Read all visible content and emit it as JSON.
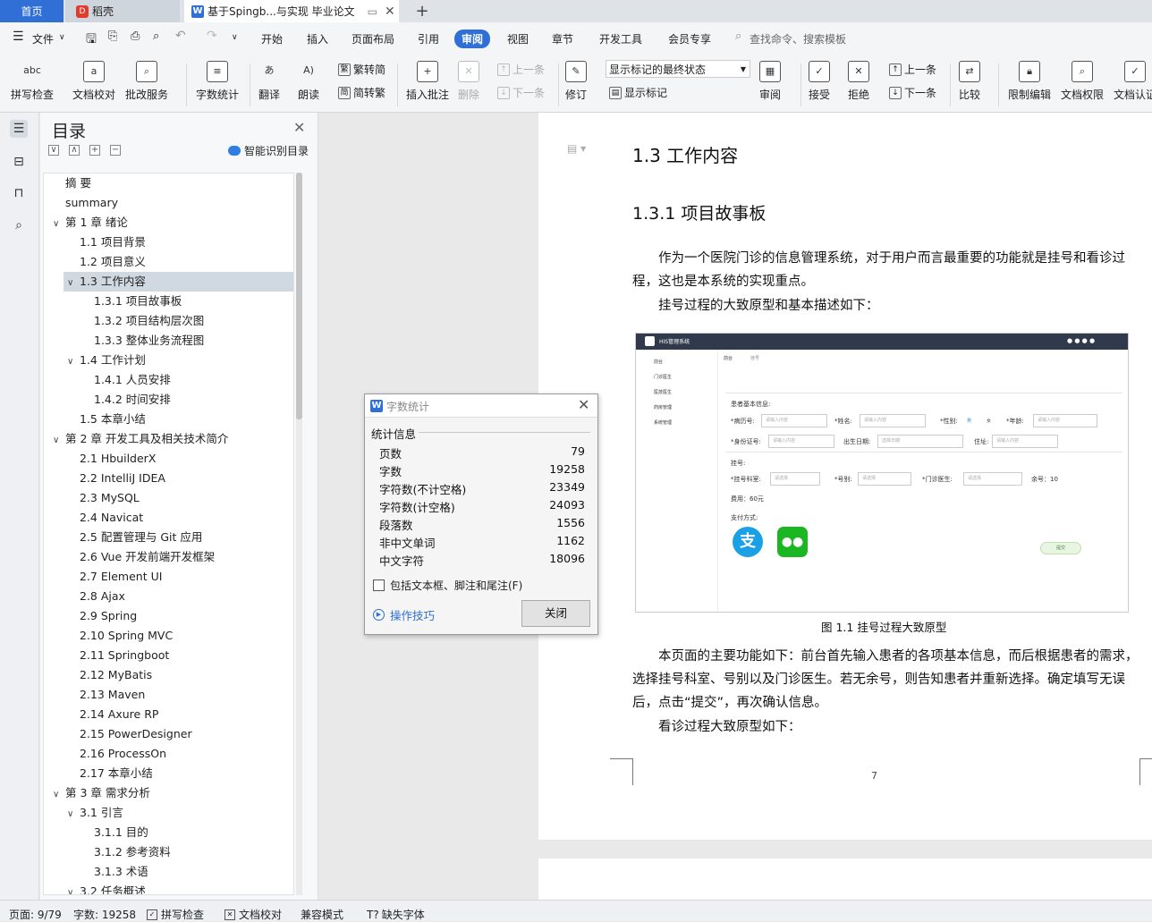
{
  "tabs": {
    "home": "首页",
    "daoke": "稻壳",
    "doc": "基于Spingb...与实现 毕业论文",
    "new_tab": "+"
  },
  "menubar": {
    "file": "文件",
    "items": [
      "开始",
      "插入",
      "页面布局",
      "引用",
      "审阅",
      "视图",
      "章节",
      "开发工具",
      "会员专享"
    ],
    "active": "审阅",
    "search_placeholder": "查找命令、搜索模板"
  },
  "ribbon": {
    "spell_check": "拼写检查",
    "doc_proof": "文档校对",
    "correction": "批改服务",
    "word_count": "字数统计",
    "translate": "翻译",
    "read_aloud": "朗读",
    "to_simplified": "繁转简",
    "to_traditional": "简转繁",
    "insert_comment": "插入批注",
    "delete": "删除",
    "prev": "上一条",
    "next": "下一条",
    "revise": "修订",
    "markup_state": "显示标记的最终状态",
    "show_markup": "显示标记",
    "review": "审阅",
    "accept": "接受",
    "reject": "拒绝",
    "prev2": "上一条",
    "next2": "下一条",
    "compare": "比较",
    "restrict_edit": "限制编辑",
    "doc_rights": "文档权限",
    "doc_cert": "文档认证"
  },
  "toc": {
    "title": "目录",
    "smart": "智能识别目录",
    "items": [
      {
        "text": "摘  要",
        "level": 0,
        "chev": ""
      },
      {
        "text": "summary",
        "level": 0,
        "chev": ""
      },
      {
        "text": "第 1 章   绪论",
        "level": 0,
        "chev": "∨"
      },
      {
        "text": "1.1  项目背景",
        "level": 1,
        "chev": ""
      },
      {
        "text": "1.2  项目意义",
        "level": 1,
        "chev": ""
      },
      {
        "text": "1.3  工作内容",
        "level": 1,
        "chev": "∨",
        "selected": true
      },
      {
        "text": "1.3.1  项目故事板",
        "level": 2,
        "chev": ""
      },
      {
        "text": "1.3.2  项目结构层次图",
        "level": 2,
        "chev": ""
      },
      {
        "text": "1.3.3  整体业务流程图",
        "level": 2,
        "chev": ""
      },
      {
        "text": "1.4  工作计划",
        "level": 1,
        "chev": "∨"
      },
      {
        "text": "1.4.1  人员安排",
        "level": 2,
        "chev": ""
      },
      {
        "text": "1.4.2  时间安排",
        "level": 2,
        "chev": ""
      },
      {
        "text": "1.5  本章小结",
        "level": 1,
        "chev": ""
      },
      {
        "text": "第 2 章   开发工具及相关技术简介",
        "level": 0,
        "chev": "∨"
      },
      {
        "text": "2.1 HbuilderX",
        "level": 1,
        "chev": ""
      },
      {
        "text": "2.2 IntelliJ IDEA",
        "level": 1,
        "chev": ""
      },
      {
        "text": "2.3 MySQL",
        "level": 1,
        "chev": ""
      },
      {
        "text": "2.4 Navicat",
        "level": 1,
        "chev": ""
      },
      {
        "text": "2.5  配置管理与 Git 应用",
        "level": 1,
        "chev": ""
      },
      {
        "text": "2.6 Vue 开发前端开发框架",
        "level": 1,
        "chev": ""
      },
      {
        "text": "2.7 Element UI",
        "level": 1,
        "chev": ""
      },
      {
        "text": "2.8 Ajax",
        "level": 1,
        "chev": ""
      },
      {
        "text": "2.9 Spring",
        "level": 1,
        "chev": ""
      },
      {
        "text": "2.10 Spring MVC",
        "level": 1,
        "chev": ""
      },
      {
        "text": "2.11 Springboot",
        "level": 1,
        "chev": ""
      },
      {
        "text": "2.12 MyBatis",
        "level": 1,
        "chev": ""
      },
      {
        "text": "2.13 Maven",
        "level": 1,
        "chev": ""
      },
      {
        "text": "2.14 Axure RP",
        "level": 1,
        "chev": ""
      },
      {
        "text": "2.15 PowerDesigner",
        "level": 1,
        "chev": ""
      },
      {
        "text": "2.16 ProcessOn",
        "level": 1,
        "chev": ""
      },
      {
        "text": "2.17  本章小结",
        "level": 1,
        "chev": ""
      },
      {
        "text": "第 3 章  需求分析",
        "level": 0,
        "chev": "∨"
      },
      {
        "text": "3.1 引言",
        "level": 1,
        "chev": "∨"
      },
      {
        "text": "3.1.1 目的",
        "level": 2,
        "chev": ""
      },
      {
        "text": "3.1.2 参考资料",
        "level": 2,
        "chev": ""
      },
      {
        "text": "3.1.3 术语",
        "level": 2,
        "chev": ""
      },
      {
        "text": "3.2 任务概述",
        "level": 1,
        "chev": "∨"
      }
    ]
  },
  "document": {
    "h2": "1.3  工作内容",
    "h3": "1.3.1  项目故事板",
    "p1": "作为一个医院门诊的信息管理系统，对于用户而言最重要的功能就是挂号和看诊过程，这也是本系统的实现重点。",
    "p2": "挂号过程的大致原型和基本描述如下：",
    "caption": "图 1.1  挂号过程大致原型",
    "p3": "本页面的主要功能如下：前台首先输入患者的各项基本信息，而后根据患者的需求，选择挂号科室、号别以及门诊医生。若无余号，则告知患者并重新选择。确定填写无误后，点击“提交”，再次确认信息。",
    "p4": "看诊过程大致原型如下：",
    "page_number": "7"
  },
  "figure": {
    "app_title": "HIS管理系统",
    "nav": [
      "前台",
      "门诊医生",
      "医技医生",
      "药房管理",
      "系统管理"
    ],
    "crumbs": [
      "前台",
      "挂号"
    ],
    "section_patient": "患者基本信息:",
    "record_no": "*病历号:",
    "name": "*姓名:",
    "gender": "*性别:",
    "male": "男",
    "female": "女",
    "age": "*年龄:",
    "id_no": "*身份证号:",
    "birth": "出生日期:",
    "address": "住址:",
    "section_reg": "挂号:",
    "dept": "*挂号科室:",
    "reg_type": "*号别:",
    "doctor": "*门诊医生:",
    "remain": "余号：10",
    "fee": "费用：60元",
    "pay": "支付方式:",
    "alipay": "支",
    "submit": "提交",
    "ph_input": "请输入内容",
    "ph_select": "请选择",
    "ph_date": "选择日期"
  },
  "dialog": {
    "title": "字数统计",
    "group": "统计信息",
    "stats": [
      {
        "label": "页数",
        "value": "79"
      },
      {
        "label": "字数",
        "value": "19258"
      },
      {
        "label": "字符数(不计空格)",
        "value": "23349"
      },
      {
        "label": "字符数(计空格)",
        "value": "24093"
      },
      {
        "label": "段落数",
        "value": "1556"
      },
      {
        "label": "非中文单词",
        "value": "1162"
      },
      {
        "label": "中文字符",
        "value": "18096"
      }
    ],
    "checkbox": "包括文本框、脚注和尾注(F)",
    "tips": "操作技巧",
    "close": "关闭"
  },
  "status": {
    "page": "页面: 9/79",
    "words": "字数: 19258",
    "spell": "拼写检查",
    "proof": "文档校对",
    "compat": "兼容模式",
    "missing_font": "缺失字体"
  },
  "colors": {
    "accent": "#2f6fd6",
    "tab_home": "#2f6fd6",
    "figure_header": "#303a4c"
  }
}
